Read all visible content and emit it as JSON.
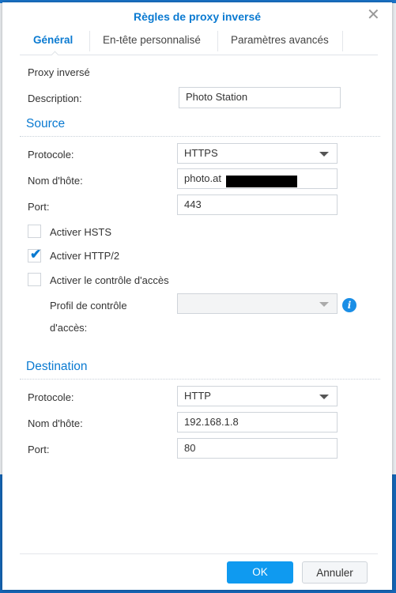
{
  "dialog": {
    "title": "Règles de proxy inversé"
  },
  "tabs": [
    {
      "label": "Général",
      "active": true
    },
    {
      "label": "En-tête personnalisé"
    },
    {
      "label": "Paramètres avancés"
    }
  ],
  "general": {
    "section_label": "Proxy inversé",
    "description_label": "Description:",
    "description_value": "Photo Station"
  },
  "source": {
    "heading": "Source",
    "protocol_label": "Protocole:",
    "protocol_value": "HTTPS",
    "hostname_label": "Nom d'hôte:",
    "hostname_value": "photo.at",
    "port_label": "Port:",
    "port_value": "443",
    "hsts_label": "Activer HSTS",
    "hsts_checked": false,
    "http2_label": "Activer HTTP/2",
    "http2_checked": true,
    "access_label": "Activer le contrôle d'accès",
    "access_checked": false,
    "profile_label_1": "Profil de contrôle",
    "profile_label_2": "d'accès:",
    "profile_value": ""
  },
  "destination": {
    "heading": "Destination",
    "protocol_label": "Protocole:",
    "protocol_value": "HTTP",
    "hostname_label": "Nom d'hôte:",
    "hostname_value": "192.168.1.8",
    "port_label": "Port:",
    "port_value": "80"
  },
  "footer": {
    "ok_label": "OK",
    "cancel_label": "Annuler"
  },
  "icons": {
    "close": "close-icon",
    "info": "info-icon",
    "check": "checkmark-icon",
    "caret": "chevron-down-icon"
  },
  "colors": {
    "accent": "#0a7ad1",
    "ok_button": "#0f9af0"
  }
}
